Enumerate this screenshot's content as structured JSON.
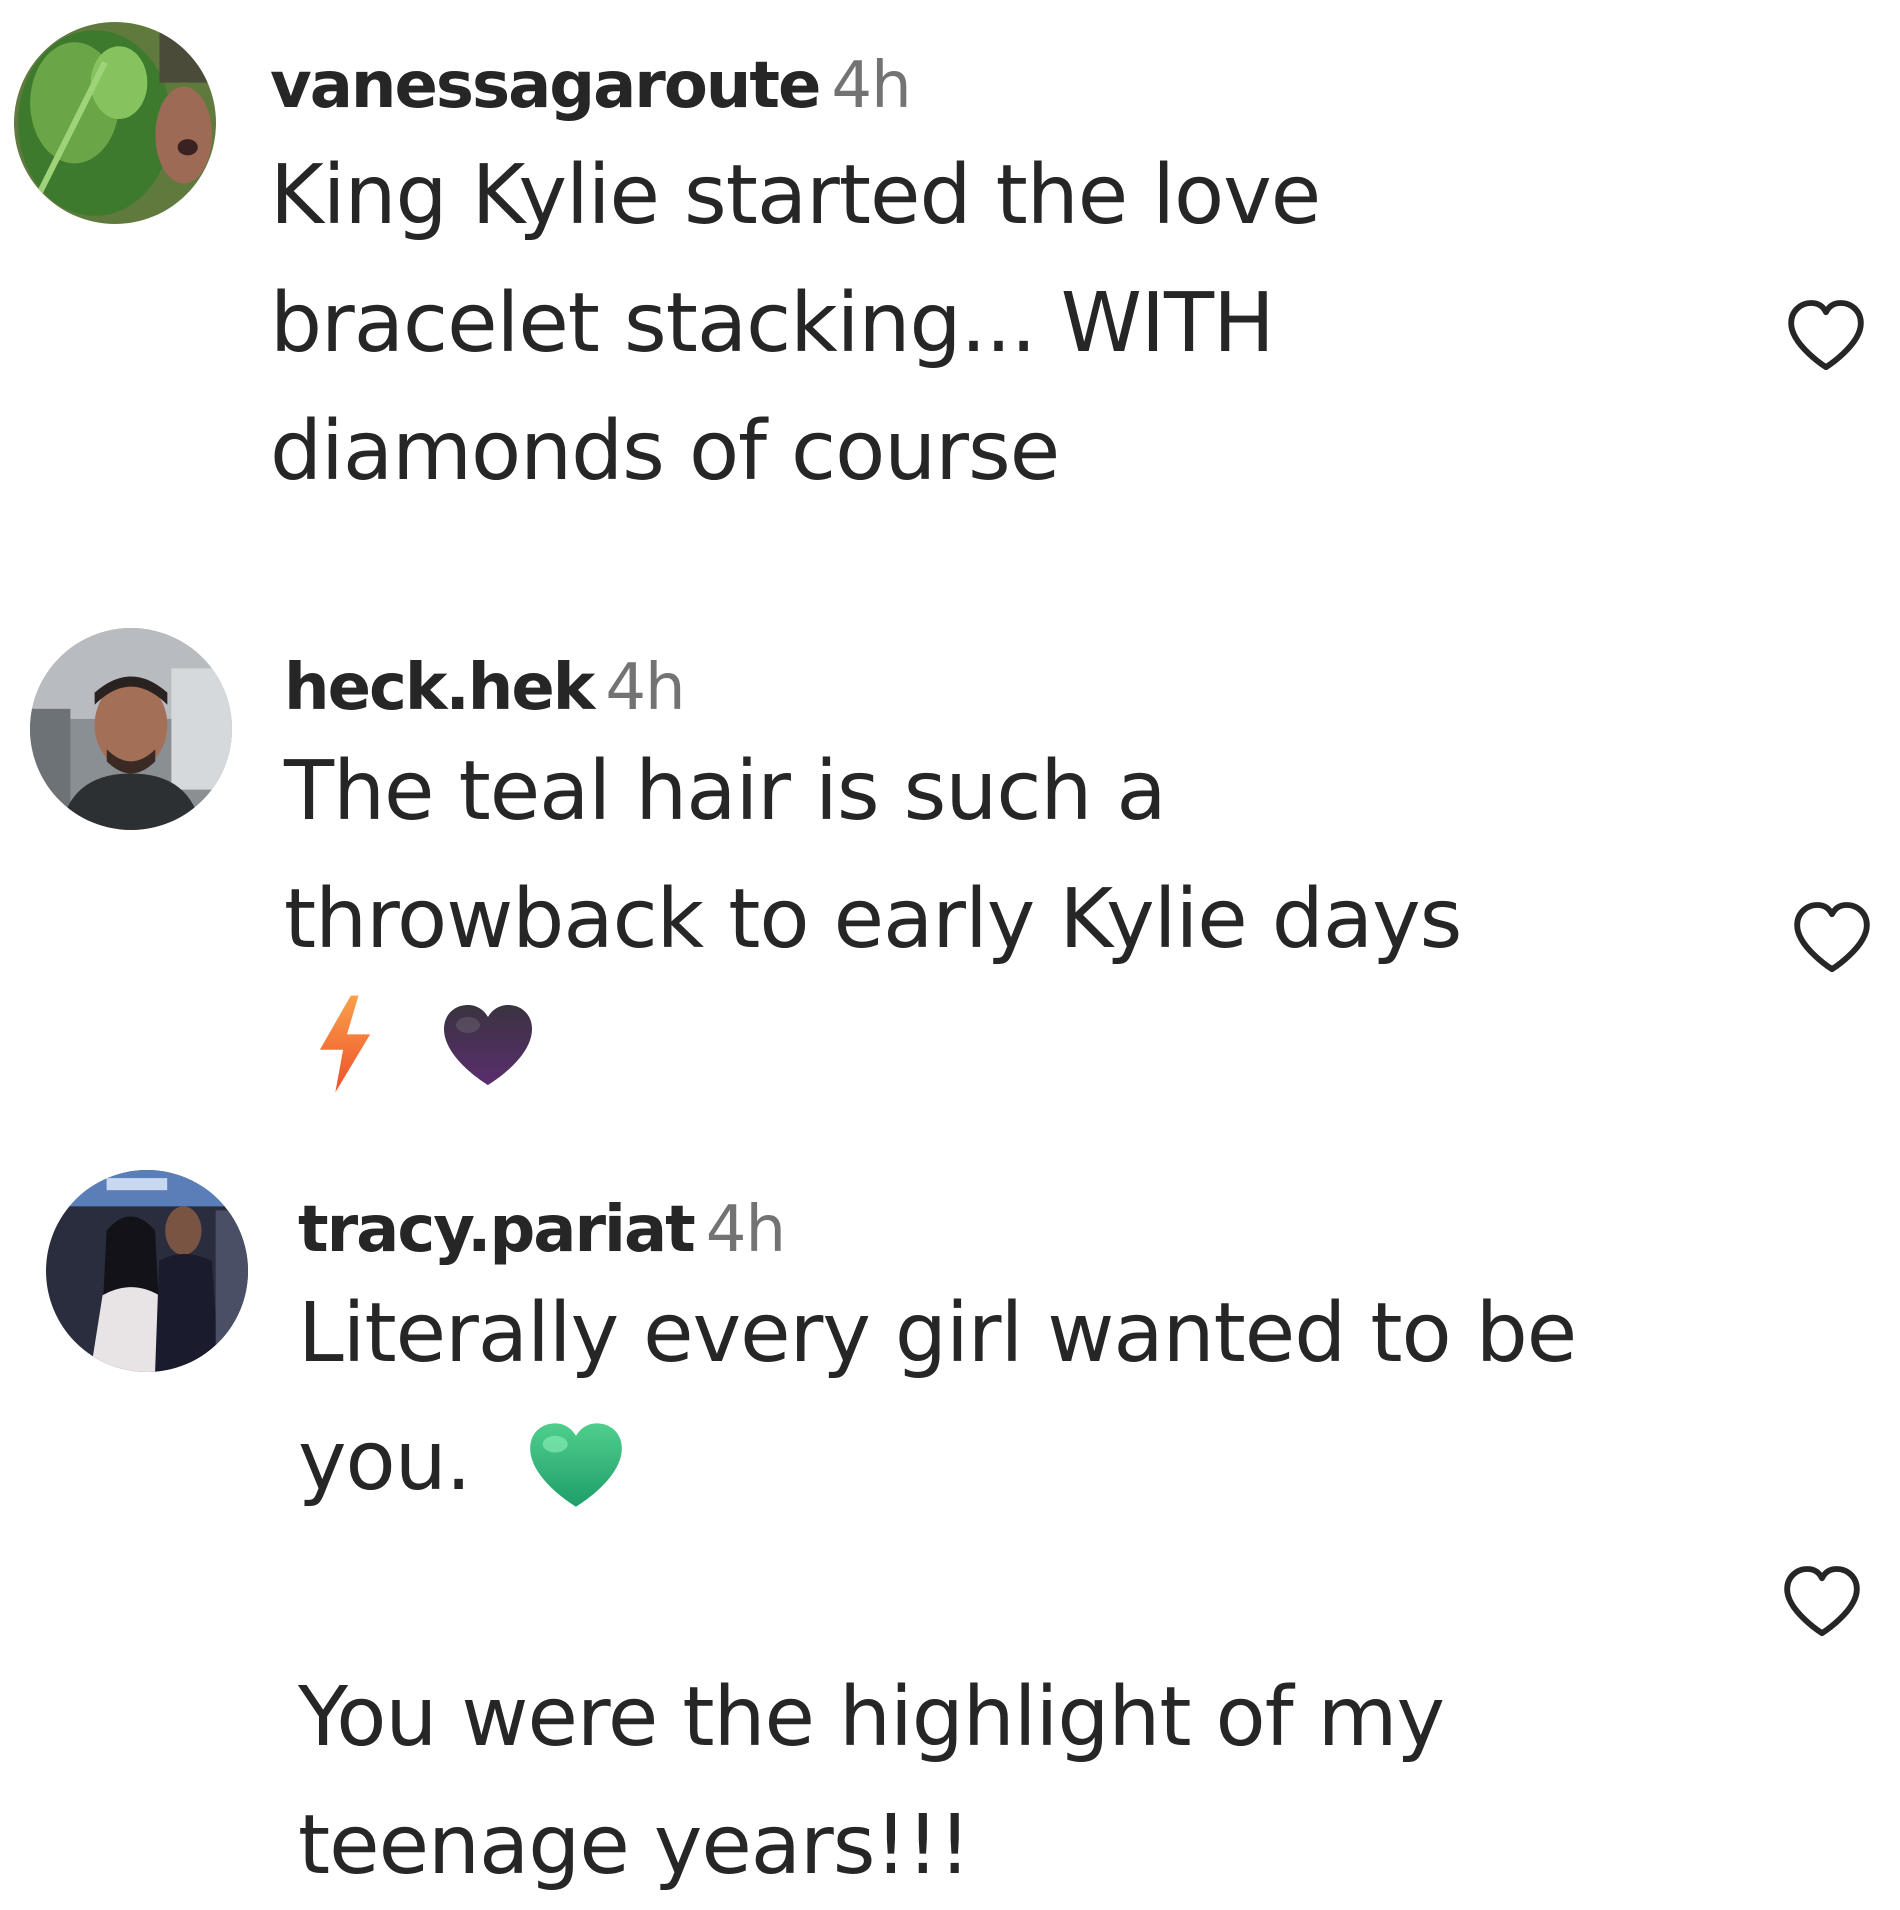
{
  "comments": [
    {
      "username": "vanessagaroute",
      "time": "4h",
      "lines": [
        "King Kylie started the love",
        "bracelet stacking... WITH",
        "diamonds of course"
      ],
      "avatar": "avatar-vanessagaroute"
    },
    {
      "username": "heck.hek",
      "time": "4h",
      "lines": [
        "The teal hair is such a",
        "throwback to early Kylie days"
      ],
      "emojis": [
        "lightning-emoji",
        "black-heart-emoji"
      ],
      "avatar": "avatar-heck-hek"
    },
    {
      "username": "tracy.pariat",
      "time": "4h",
      "lines": [
        "Literally every girl wanted to be",
        "you."
      ],
      "emojis": [
        "green-heart-emoji"
      ],
      "lines2": [
        "You were the highlight of my",
        "teenage years!!!"
      ],
      "avatar": "avatar-tracy-pariat"
    }
  ],
  "colors": {
    "text": "#262626",
    "secondary": "#737373",
    "icon": "#262626",
    "green_heart": "#2ebd78",
    "black_heart": "#2b2233",
    "lightning": "#f4733a"
  }
}
